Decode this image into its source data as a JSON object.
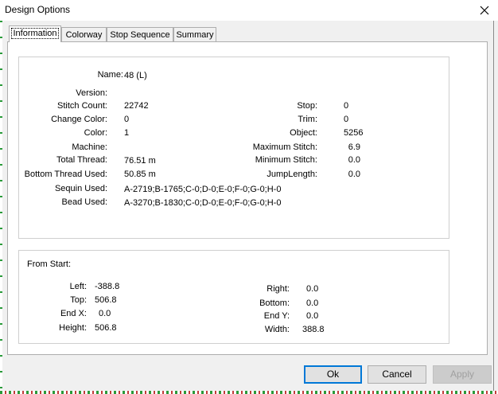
{
  "window": {
    "title": "Design Options"
  },
  "tabs": [
    "Information",
    "Colorway",
    "Stop Sequence",
    "Summary"
  ],
  "info": {
    "name_label": "Name:",
    "name_value": "48 (L)",
    "version_label": "Version:",
    "version_value": "",
    "stitch_count_label": "Stitch Count:",
    "stitch_count_value": "22742",
    "change_color_label": "Change Color:",
    "change_color_value": "0",
    "color_label": "Color:",
    "color_value": "1",
    "machine_label": "Machine:",
    "machine_value": "",
    "total_thread_label": "Total Thread:",
    "total_thread_value": "76.51 m",
    "bottom_thread_label": "Bottom Thread Used:",
    "bottom_thread_value": "50.85 m",
    "sequin_label": "Sequin Used:",
    "sequin_value": "A-2719;B-1765;C-0;D-0;E-0;F-0;G-0;H-0",
    "bead_label": "Bead Used:",
    "bead_value": "A-3270;B-1830;C-0;D-0;E-0;F-0;G-0;H-0",
    "stop_label": "Stop:",
    "stop_value": "0",
    "trim_label": "Trim:",
    "trim_value": "0",
    "object_label": "Object:",
    "object_value": "5256",
    "max_stitch_label": "Maximum Stitch:",
    "max_stitch_value": "6.9",
    "min_stitch_label": "Minimum Stitch:",
    "min_stitch_value": "0.0",
    "jump_label": "JumpLength:",
    "jump_value": "0.0"
  },
  "from_start": {
    "heading": "From Start:",
    "left_label": "Left:",
    "left_value": "-388.8",
    "top_label": "Top:",
    "top_value": "506.8",
    "endx_label": "End X:",
    "endx_value": "0.0",
    "height_label": "Height:",
    "height_value": "506.8",
    "right_label": "Right:",
    "right_value": "0.0",
    "bottom_label": "Bottom:",
    "bottom_value": "0.0",
    "endy_label": "End Y:",
    "endy_value": "0.0",
    "width_label": "Width:",
    "width_value": "388.8"
  },
  "buttons": {
    "ok": "Ok",
    "cancel": "Cancel",
    "apply": "Apply"
  },
  "icons": {
    "close": "close-icon"
  },
  "colors": {
    "accent": "#0078d7",
    "panel_bg": "#f0f0f0"
  }
}
